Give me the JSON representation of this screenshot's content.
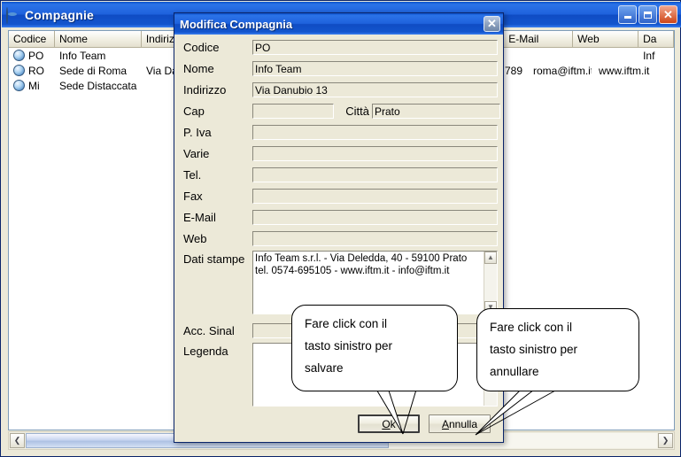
{
  "background_window": {
    "title": "Compagnie",
    "icon": "globe-icon",
    "window_buttons": {
      "minimize": "minimize-icon",
      "maximize": "maximize-icon",
      "close": "close-icon"
    },
    "list": {
      "columns": [
        "Codice",
        "Nome",
        "Indirizzo",
        "E-Mail",
        "Web",
        "Da"
      ],
      "rows": [
        {
          "icon": "globe-icon",
          "codice": "PO",
          "nome": "Info Team",
          "indirizzo": "",
          "numero": "",
          "email": "",
          "web": "",
          "da": "Inf"
        },
        {
          "icon": "globe-icon",
          "codice": "RO",
          "nome": "Sede di Roma",
          "indirizzo": "Via Da",
          "numero": "789",
          "email": "roma@iftm.it",
          "web": "www.iftm.it",
          "da": ""
        },
        {
          "icon": "globe-icon",
          "codice": "Mi",
          "nome": "Sede Distaccata",
          "indirizzo": "",
          "numero": "",
          "email": "",
          "web": "",
          "da": ""
        }
      ]
    },
    "scrollbar": {
      "left_arrow": "chevron-left-icon",
      "right_arrow": "chevron-right-icon"
    }
  },
  "dialog": {
    "title": "Modifica Compagnia",
    "close_label": "✕",
    "fields": {
      "codice": {
        "label": "Codice",
        "value": "PO"
      },
      "nome": {
        "label": "Nome",
        "value": "Info Team"
      },
      "indirizzo": {
        "label": "Indirizzo",
        "value": "Via Danubio 13"
      },
      "cap": {
        "label": "Cap",
        "value": ""
      },
      "citta": {
        "label": "Città",
        "value": "Prato"
      },
      "piva": {
        "label": "P. Iva",
        "value": ""
      },
      "varie": {
        "label": "Varie",
        "value": ""
      },
      "tel": {
        "label": "Tel.",
        "value": ""
      },
      "fax": {
        "label": "Fax",
        "value": ""
      },
      "email": {
        "label": "E-Mail",
        "value": ""
      },
      "web": {
        "label": "Web",
        "value": ""
      },
      "dati_stampe": {
        "label": "Dati stampe",
        "line1": "Info Team s.r.l. - Via Deledda, 40 - 59100 Prato",
        "line2": "tel. 0574-695105 - www.iftm.it - info@iftm.it"
      },
      "acc_sinal": {
        "label": "Acc. Sinal",
        "value": ""
      },
      "legenda": {
        "label": "Legenda",
        "value": ""
      }
    },
    "buttons": {
      "ok": {
        "prefix": "O",
        "accel": "k",
        "full": "Ok"
      },
      "cancel": {
        "prefix": "A",
        "accel": "nnulla",
        "full": "Annulla"
      }
    }
  },
  "callouts": [
    {
      "id": "save",
      "line1": "Fare click con il",
      "line2": "tasto sinistro per",
      "line3": "salvare"
    },
    {
      "id": "cancel",
      "line1": "Fare click con il",
      "line2": "tasto sinistro per",
      "line3": "annullare"
    }
  ],
  "colors": {
    "titlebar_blue": "#1f62dd",
    "dialog_face": "#ece9d8",
    "border_navy": "#0a246a"
  }
}
